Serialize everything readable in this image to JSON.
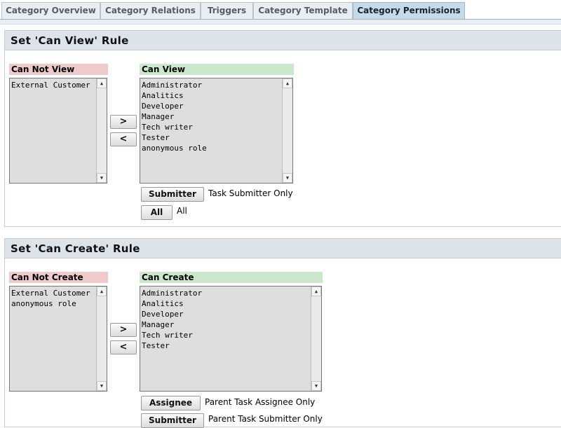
{
  "tabs": [
    "Category Overview",
    "Category Relations",
    "Triggers",
    "Category Template",
    "Category Permissions"
  ],
  "active_tab": "Category Permissions",
  "view_rule": {
    "title": "Set 'Can View' Rule",
    "left_label": "Can Not View",
    "right_label": "Can View",
    "left_items": [
      "External Customer"
    ],
    "right_items": [
      "Administrator",
      "Analitics",
      "Developer",
      "Manager",
      "Tech writer",
      "Tester",
      "anonymous role"
    ],
    "move_right": ">",
    "move_left": "<",
    "options": [
      {
        "button": "Submitter",
        "text": "Task Submitter Only"
      },
      {
        "button": "All",
        "text": "All"
      }
    ]
  },
  "create_rule": {
    "title": "Set 'Can Create' Rule",
    "left_label": "Can Not Create",
    "right_label": "Can Create",
    "left_items": [
      "External Customer",
      "anonymous role"
    ],
    "right_items": [
      "Administrator",
      "Analitics",
      "Developer",
      "Manager",
      "Tech writer",
      "Tester"
    ],
    "move_right": ">",
    "move_left": "<",
    "options": [
      {
        "button": "Assignee",
        "text": "Parent Task Assignee Only"
      },
      {
        "button": "Submitter",
        "text": "Parent Task Submitter Only"
      }
    ]
  }
}
